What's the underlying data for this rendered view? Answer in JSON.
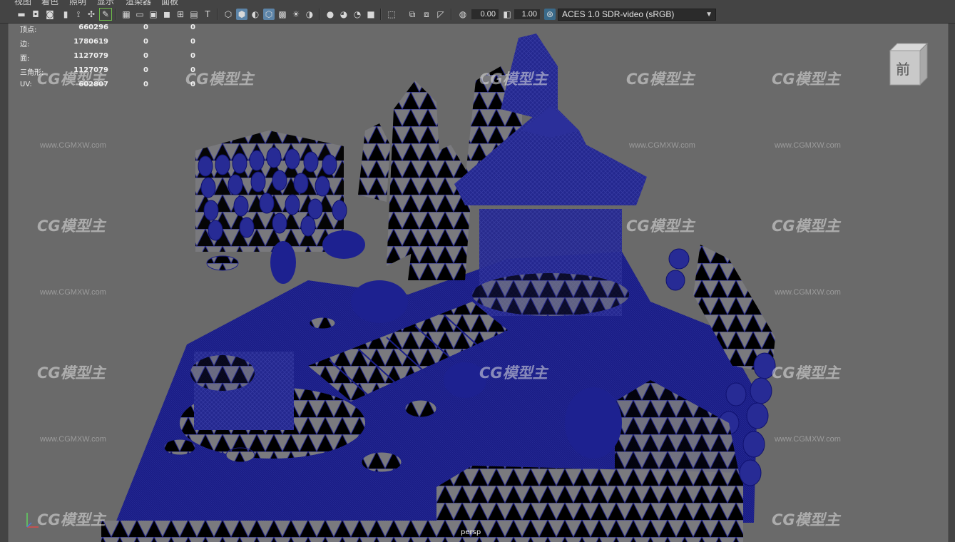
{
  "menu": [
    "视图",
    "着色",
    "照明",
    "显示",
    "渲染器",
    "面板"
  ],
  "toolbar": {
    "exposure_value": "0.00",
    "gamma_value": "1.00",
    "color_space": "ACES 1.0 SDR-video (sRGB)",
    "icons": [
      "camera-icon",
      "camera-attr-icon",
      "bookmark-icon",
      "image-plane-icon",
      "grid-icon",
      "film-gate-icon",
      "resolution-gate-icon",
      "gate-mask-icon",
      "field-chart-icon",
      "safe-action-icon",
      "safe-title-icon",
      "wireframe-icon",
      "smooth-shade-icon",
      "wireframe-on-shaded-icon",
      "textured-icon",
      "use-lights-icon",
      "shadows-icon",
      "screen-space-ao-icon",
      "motion-blur-icon",
      "anti-aliasing-icon",
      "depth-of-field-icon",
      "isolate-select-icon",
      "xray-icon",
      "xray-joints-icon",
      "xray-active-icon",
      "backface-culling-icon",
      "exposure-icon",
      "gamma-icon",
      "color-management-icon",
      "dropdown-arrow-icon"
    ]
  },
  "hud": {
    "stats": [
      {
        "label": "顶点:",
        "v1": "660296",
        "v2": "0",
        "v3": "0"
      },
      {
        "label": "边:",
        "v1": "1780619",
        "v2": "0",
        "v3": "0"
      },
      {
        "label": "面:",
        "v1": "1127079",
        "v2": "0",
        "v3": "0"
      },
      {
        "label": "三角形:",
        "v1": "1127079",
        "v2": "0",
        "v3": "0"
      },
      {
        "label": "UV:",
        "v1": "602807",
        "v2": "0",
        "v3": "0"
      }
    ],
    "camera": "persp",
    "viewcube_face": "前"
  },
  "watermark": {
    "logo": "CG模型主",
    "url": "www.CGMXW.com"
  },
  "colors": {
    "wire": "#1b1f8a",
    "viewport_bg": "#6a6a6a",
    "toolbar_bg": "#444444",
    "active_icon": "#5c84a8"
  }
}
